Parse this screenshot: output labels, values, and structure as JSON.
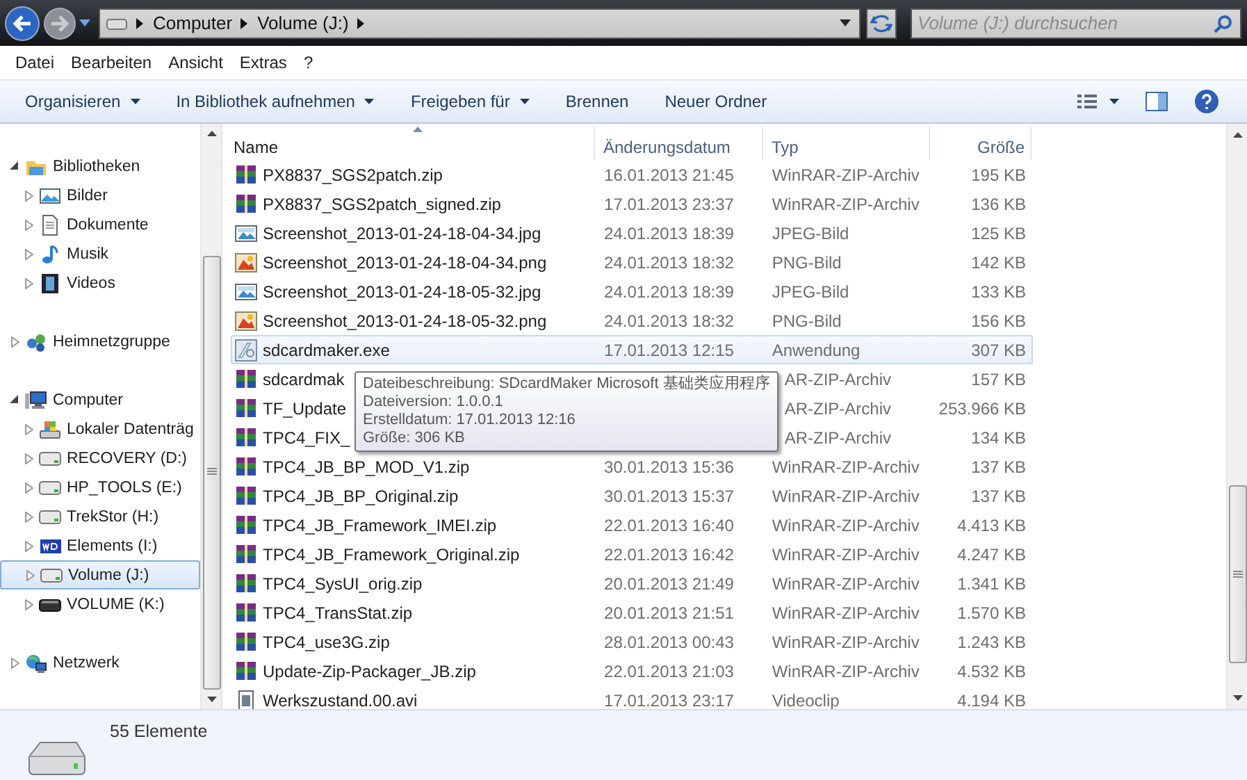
{
  "address": {
    "crumbs": [
      "Computer",
      "Volume (J:)"
    ]
  },
  "search": {
    "placeholder": "Volume (J:) durchsuchen"
  },
  "menu": [
    "Datei",
    "Bearbeiten",
    "Ansicht",
    "Extras",
    "?"
  ],
  "toolbar": [
    {
      "label": "Organisieren",
      "dropdown": true
    },
    {
      "label": "In Bibliothek aufnehmen",
      "dropdown": true
    },
    {
      "label": "Freigeben für",
      "dropdown": true
    },
    {
      "label": "Brennen",
      "dropdown": false
    },
    {
      "label": "Neuer Ordner",
      "dropdown": false
    }
  ],
  "sidebar": {
    "groups": [
      {
        "label": "Bibliotheken",
        "kind": "library",
        "expanded": true,
        "selected": false,
        "children": [
          {
            "label": "Bilder",
            "kind": "pictures",
            "expanded": false,
            "selected": false
          },
          {
            "label": "Dokumente",
            "kind": "documents",
            "expanded": false,
            "selected": false
          },
          {
            "label": "Musik",
            "kind": "music",
            "expanded": false,
            "selected": false
          },
          {
            "label": "Videos",
            "kind": "videos",
            "expanded": false,
            "selected": false
          }
        ]
      },
      {
        "label": "Heimnetzgruppe",
        "kind": "homegroup",
        "expanded": false,
        "selected": false
      },
      {
        "label": "Computer",
        "kind": "computer",
        "expanded": true,
        "selected": false,
        "children": [
          {
            "label": "Lokaler Datenträg",
            "kind": "system-drive",
            "expanded": false,
            "selected": false
          },
          {
            "label": "RECOVERY (D:)",
            "kind": "drive",
            "expanded": false,
            "selected": false
          },
          {
            "label": "HP_TOOLS (E:)",
            "kind": "drive",
            "expanded": false,
            "selected": false
          },
          {
            "label": "TrekStor (H:)",
            "kind": "drive",
            "expanded": false,
            "selected": false
          },
          {
            "label": "Elements (I:)",
            "kind": "wd-drive",
            "expanded": false,
            "selected": false
          },
          {
            "label": "Volume (J:)",
            "kind": "drive",
            "expanded": false,
            "selected": true
          },
          {
            "label": "VOLUME (K:)",
            "kind": "removable",
            "expanded": false,
            "selected": false
          }
        ]
      },
      {
        "label": "Netzwerk",
        "kind": "network",
        "expanded": false,
        "selected": false
      }
    ]
  },
  "table": {
    "columns": [
      {
        "label": "Name",
        "sorted": true
      },
      {
        "label": "Änderungsdatum",
        "sorted": false
      },
      {
        "label": "Typ",
        "sorted": false
      },
      {
        "label": "Größe",
        "sorted": false
      }
    ],
    "rows": [
      {
        "kind": "zip",
        "name": "PX8837_SGS2patch.zip",
        "date": "16.01.2013 21:45",
        "type": "WinRAR-ZIP-Archiv",
        "size": "195 KB",
        "selected": false
      },
      {
        "kind": "zip",
        "name": "PX8837_SGS2patch_signed.zip",
        "date": "17.01.2013 23:37",
        "type": "WinRAR-ZIP-Archiv",
        "size": "136 KB",
        "selected": false
      },
      {
        "kind": "jpg",
        "name": "Screenshot_2013-01-24-18-04-34.jpg",
        "date": "24.01.2013 18:39",
        "type": "JPEG-Bild",
        "size": "125 KB",
        "selected": false
      },
      {
        "kind": "png",
        "name": "Screenshot_2013-01-24-18-04-34.png",
        "date": "24.01.2013 18:32",
        "type": "PNG-Bild",
        "size": "142 KB",
        "selected": false
      },
      {
        "kind": "jpg",
        "name": "Screenshot_2013-01-24-18-05-32.jpg",
        "date": "24.01.2013 18:39",
        "type": "JPEG-Bild",
        "size": "133 KB",
        "selected": false
      },
      {
        "kind": "png",
        "name": "Screenshot_2013-01-24-18-05-32.png",
        "date": "24.01.2013 18:32",
        "type": "PNG-Bild",
        "size": "156 KB",
        "selected": false
      },
      {
        "kind": "exe",
        "name": "sdcardmaker.exe",
        "date": "17.01.2013 12:15",
        "type": "Anwendung",
        "size": "307 KB",
        "selected": true
      },
      {
        "kind": "zip",
        "name": "sdcardmak",
        "type": "AR-ZIP-Archiv",
        "size": "157 KB",
        "selected": false
      },
      {
        "kind": "zip",
        "name": "TF_Update",
        "type": "AR-ZIP-Archiv",
        "size": "253.966 KB",
        "selected": false
      },
      {
        "kind": "zip",
        "name": "TPC4_FIX_",
        "type": "AR-ZIP-Archiv",
        "size": "134 KB",
        "selected": false
      },
      {
        "kind": "zip",
        "name": "TPC4_JB_BP_MOD_V1.zip",
        "date": "30.01.2013 15:36",
        "type": "WinRAR-ZIP-Archiv",
        "size": "137 KB",
        "selected": false
      },
      {
        "kind": "zip",
        "name": "TPC4_JB_BP_Original.zip",
        "date": "30.01.2013 15:37",
        "type": "WinRAR-ZIP-Archiv",
        "size": "137 KB",
        "selected": false
      },
      {
        "kind": "zip",
        "name": "TPC4_JB_Framework_IMEI.zip",
        "date": "22.01.2013 16:40",
        "type": "WinRAR-ZIP-Archiv",
        "size": "4.413 KB",
        "selected": false
      },
      {
        "kind": "zip",
        "name": "TPC4_JB_Framework_Original.zip",
        "date": "22.01.2013 16:42",
        "type": "WinRAR-ZIP-Archiv",
        "size": "4.247 KB",
        "selected": false
      },
      {
        "kind": "zip",
        "name": "TPC4_SysUI_orig.zip",
        "date": "20.01.2013 21:49",
        "type": "WinRAR-ZIP-Archiv",
        "size": "1.341 KB",
        "selected": false
      },
      {
        "kind": "zip",
        "name": "TPC4_TransStat.zip",
        "date": "20.01.2013 21:51",
        "type": "WinRAR-ZIP-Archiv",
        "size": "1.570 KB",
        "selected": false
      },
      {
        "kind": "zip",
        "name": "TPC4_use3G.zip",
        "date": "28.01.2013 00:43",
        "type": "WinRAR-ZIP-Archiv",
        "size": "1.243 KB",
        "selected": false
      },
      {
        "kind": "zip",
        "name": "Update-Zip-Packager_JB.zip",
        "date": "22.01.2013 21:03",
        "type": "WinRAR-ZIP-Archiv",
        "size": "4.532 KB",
        "selected": false
      },
      {
        "kind": "avi",
        "name": "Werkszustand.00.avi",
        "date": "17.01.2013 23:17",
        "type": "Videoclip",
        "size": "4.194 KB",
        "selected": false
      }
    ]
  },
  "tooltip": {
    "lines": [
      "Dateibeschreibung: SDcardMaker Microsoft 基础类应用程序",
      "Dateiversion: 1.0.0.1",
      "Erstelldatum: 17.01.2013 12:16",
      "Größe: 306 KB"
    ]
  },
  "status_bar": {
    "text": "55 Elemente"
  }
}
